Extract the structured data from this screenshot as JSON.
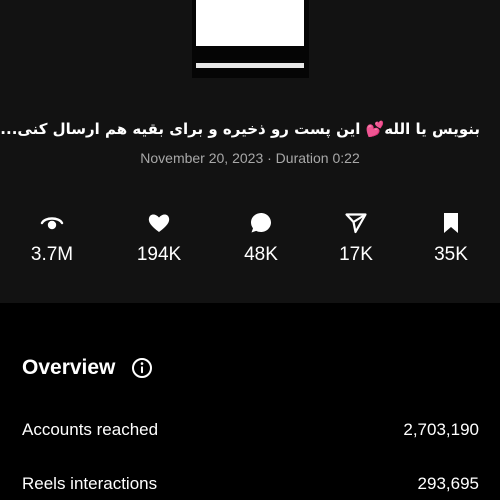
{
  "post": {
    "caption": "بنویس یا الله💕 این پست رو ذخیره و برای بقیه هم ارسال کنی...",
    "meta": "November 20, 2023 · Duration 0:22"
  },
  "metrics": [
    {
      "icon": "views-icon",
      "value": "3.7M"
    },
    {
      "icon": "heart-icon",
      "value": "194K"
    },
    {
      "icon": "comment-icon",
      "value": "48K"
    },
    {
      "icon": "share-icon",
      "value": "17K"
    },
    {
      "icon": "bookmark-icon",
      "value": "35K"
    }
  ],
  "overview": {
    "title": "Overview",
    "info_icon": "info-icon",
    "rows": [
      {
        "label": "Accounts reached",
        "value": "2,703,190"
      },
      {
        "label": "Reels interactions",
        "value": "293,695"
      }
    ]
  },
  "colors": {
    "background": "#000000",
    "panel": "#121212",
    "text": "#ffffff",
    "secondary_text": "#a8a8a8"
  }
}
